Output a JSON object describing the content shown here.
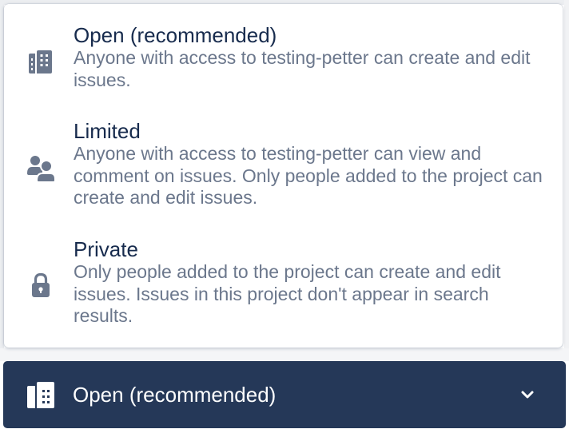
{
  "project_name": "testing-petter",
  "permission_menu": {
    "options": [
      {
        "icon": "building-icon",
        "title": "Open (recommended)",
        "description": "Anyone with access to testing-petter can create and edit issues."
      },
      {
        "icon": "people-icon",
        "title": "Limited",
        "description": "Anyone with access to testing-petter can view and comment on issues. Only people added to the project can create and edit issues."
      },
      {
        "icon": "lock-icon",
        "title": "Private",
        "description": "Only people added to the project can create and edit issues. Issues in this project don't appear in search results."
      }
    ]
  },
  "select": {
    "icon": "building-icon",
    "selected_label": "Open (recommended)",
    "chevron_icon": "chevron-down-icon"
  },
  "colors": {
    "title_text": "#172b4d",
    "description_text": "#6b778c",
    "icon": "#6b778c",
    "trigger_background": "#253858",
    "trigger_text": "#ffffff"
  }
}
